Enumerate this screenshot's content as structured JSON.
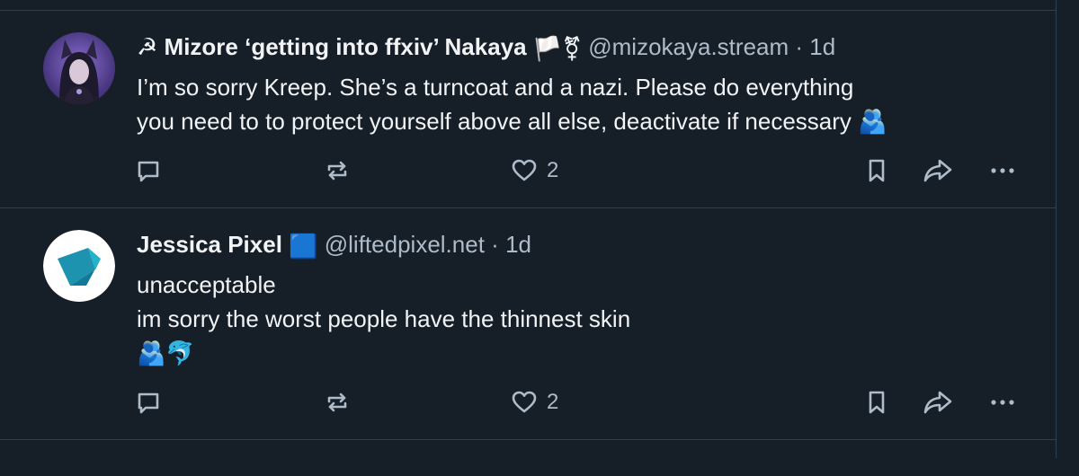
{
  "posts": [
    {
      "display_name": "☭ Mizore ‘getting into ffxiv’ Nakaya",
      "name_emoji": "🏳️⚧",
      "handle": "@mizokaya.stream",
      "separator": "·",
      "time": "1d",
      "lines": [
        "I’m so sorry Kreep. She’s a turncoat and a nazi. Please do everything",
        "you need to to protect yourself above all else, deactivate if necessary 🫂"
      ],
      "like_count": "2",
      "avatar_icon": "anime-catgirl-avatar"
    },
    {
      "display_name": "Jessica Pixel",
      "name_emoji": "🟦",
      "handle": "@liftedpixel.net",
      "separator": "·",
      "time": "1d",
      "lines": [
        "unacceptable",
        "im sorry the worst people have the thinnest skin",
        "🫂🐬"
      ],
      "like_count": "2",
      "avatar_icon": "blue-cube-avatar"
    }
  ],
  "colors": {
    "background": "#161e27",
    "border": "#2e4052",
    "text": "#f1f3f5",
    "muted": "#aebbc9"
  },
  "icons": [
    "reply-icon",
    "repost-icon",
    "like-icon",
    "bookmark-icon",
    "share-icon",
    "more-icon"
  ]
}
